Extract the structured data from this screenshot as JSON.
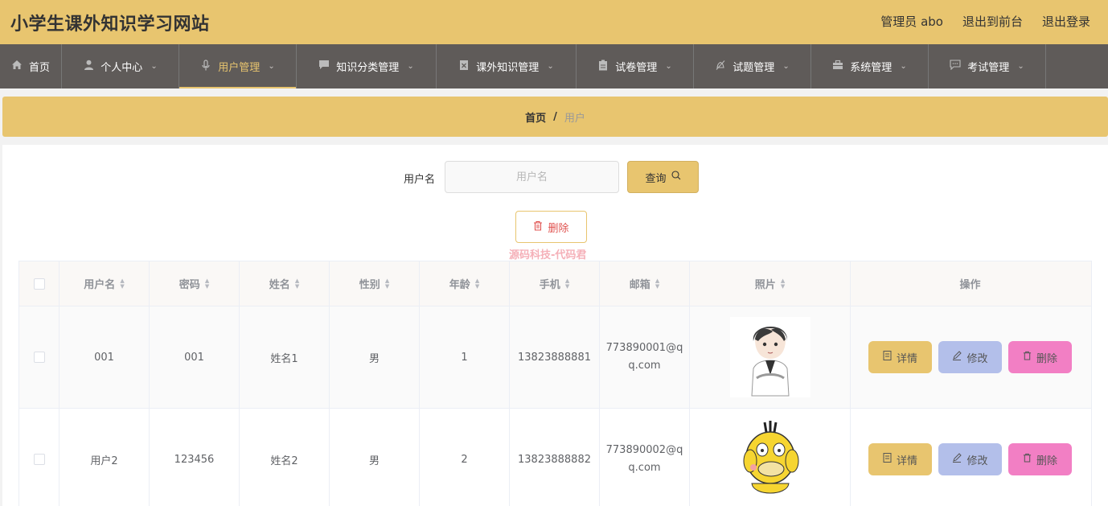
{
  "header": {
    "title": "小学生课外知识学习网站",
    "admin": "管理员 abo",
    "to_front": "退出到前台",
    "logout": "退出登录"
  },
  "nav": [
    {
      "label": "首页",
      "icon": "home-icon"
    },
    {
      "label": "个人中心",
      "icon": "user-icon"
    },
    {
      "label": "用户管理",
      "icon": "microphone-icon"
    },
    {
      "label": "知识分类管理",
      "icon": "chat-icon"
    },
    {
      "label": "课外知识管理",
      "icon": "clipboard-x-icon"
    },
    {
      "label": "试卷管理",
      "icon": "clipboard-icon"
    },
    {
      "label": "试题管理",
      "icon": "bell-off-icon"
    },
    {
      "label": "系统管理",
      "icon": "briefcase-icon"
    },
    {
      "label": "考试管理",
      "icon": "message-icon"
    }
  ],
  "breadcrumb": {
    "home": "首页",
    "sep": "/",
    "current": "用户"
  },
  "search": {
    "label": "用户名",
    "placeholder": "用户名",
    "value": "",
    "button": "查询"
  },
  "delete_button": "删除",
  "watermark": "源码科技-代码君",
  "table": {
    "columns": [
      "用户名",
      "密码",
      "姓名",
      "性别",
      "年龄",
      "手机",
      "邮箱",
      "照片",
      "操作"
    ],
    "rows": [
      {
        "username": "001",
        "password": "001",
        "name": "姓名1",
        "gender": "男",
        "age": "1",
        "phone": "13823888881",
        "email": "773890001@qq.com"
      },
      {
        "username": "用户2",
        "password": "123456",
        "name": "姓名2",
        "gender": "男",
        "age": "2",
        "phone": "13823888882",
        "email": "773890002@qq.com"
      }
    ],
    "actions": {
      "detail": "详情",
      "edit": "修改",
      "delete": "删除"
    }
  },
  "colors": {
    "accent": "#e8c56f",
    "nav_bg": "#5f5b59",
    "edit": "#b3bfea",
    "delete": "#f27fc4"
  }
}
